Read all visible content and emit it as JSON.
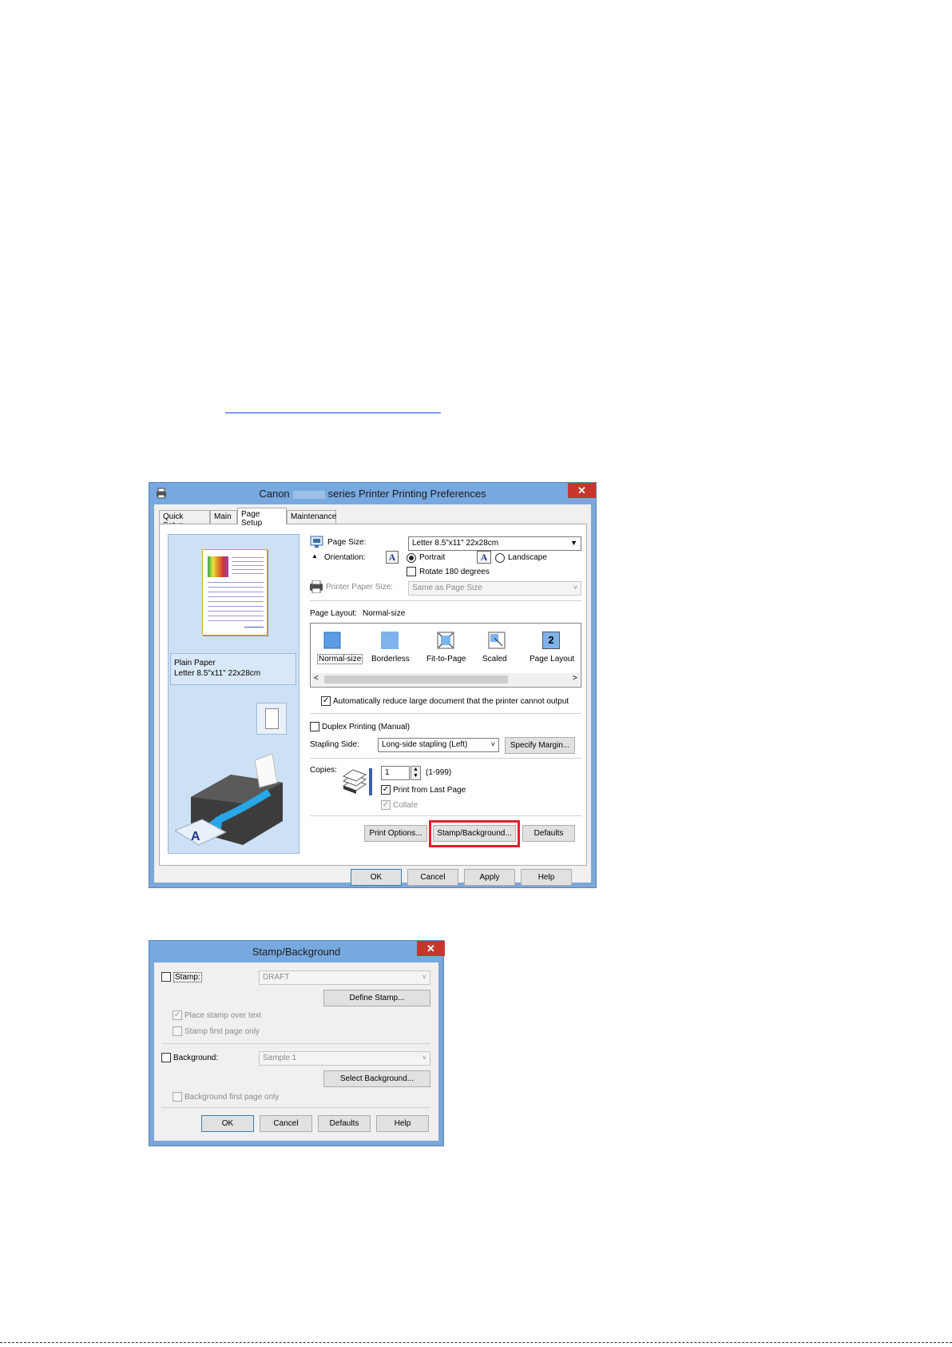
{
  "page": {
    "link_text": ""
  },
  "window1": {
    "title_prefix": "Canon",
    "title_suffix": "series Printer Printing Preferences",
    "close_symbol": "✕",
    "tabs": [
      "Quick Setup",
      "Main",
      "Page Setup",
      "Maintenance"
    ],
    "active_tab": "Page Setup",
    "preview": {
      "media_type": "Plain Paper",
      "media_size": "Letter 8.5\"x11\" 22x28cm"
    },
    "page_size": {
      "label": "Page Size:",
      "value": "Letter 8.5\"x11\" 22x28cm"
    },
    "orientation": {
      "label": "Orientation:",
      "portrait": "Portrait",
      "landscape": "Landscape",
      "selected": "Portrait",
      "rotate_label": "Rotate 180 degrees",
      "rotate_checked": false
    },
    "printer_paper_size": {
      "label": "Printer Paper Size:",
      "value": "Same as Page Size",
      "disabled": true
    },
    "page_layout": {
      "label": "Page Layout:",
      "current": "Normal-size",
      "options": [
        "Normal-size",
        "Borderless",
        "Fit-to-Page",
        "Scaled",
        "Page Layout"
      ],
      "page_layout_icon_number": "2"
    },
    "auto_reduce": {
      "label": "Automatically reduce large document that the printer cannot output",
      "checked": true
    },
    "duplex": {
      "label": "Duplex Printing (Manual)",
      "checked": false
    },
    "stapling": {
      "label": "Stapling Side:",
      "value": "Long-side stapling (Left)",
      "margin_button": "Specify Margin..."
    },
    "copies": {
      "label": "Copies:",
      "value": "1",
      "range": "(1-999)",
      "print_from_last_label": "Print from Last Page",
      "print_from_last_checked": true,
      "collate_label": "Collate",
      "collate_checked": true,
      "collate_disabled": true
    },
    "buttons": {
      "print_options": "Print Options...",
      "stamp_background": "Stamp/Background...",
      "defaults": "Defaults"
    },
    "bottom_buttons": [
      "OK",
      "Cancel",
      "Apply",
      "Help"
    ],
    "highlight_color": "#e0212b"
  },
  "window2": {
    "title": "Stamp/Background",
    "close_symbol": "✕",
    "stamp": {
      "label": "Stamp:",
      "checked": false,
      "value": "DRAFT",
      "define_button": "Define Stamp...",
      "place_over_text_label": "Place stamp over text",
      "place_over_text_checked": true,
      "first_page_only_label": "Stamp first page only",
      "first_page_only_checked": false
    },
    "background": {
      "label": "Background:",
      "checked": false,
      "value": "Sample 1",
      "select_button": "Select Background...",
      "first_page_only_label": "Background first page only",
      "first_page_only_checked": false
    },
    "bottom_buttons": [
      "OK",
      "Cancel",
      "Defaults",
      "Help"
    ]
  }
}
